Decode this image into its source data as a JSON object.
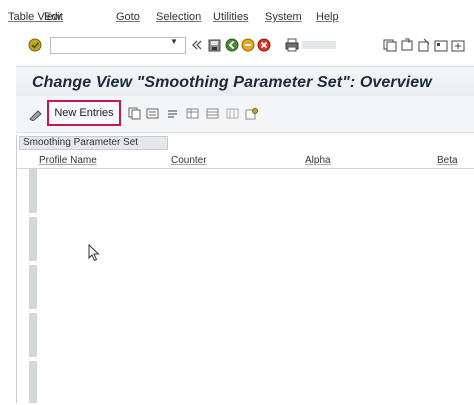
{
  "menu": {
    "items": [
      "Table View",
      "Edit",
      "Goto",
      "Selection",
      "Utilities",
      "System",
      "Help"
    ]
  },
  "toolbar": {
    "command_field_value": "",
    "icons": [
      "enter-icon",
      "back-icon",
      "exit-icon",
      "cancel-icon",
      "print-icon",
      "find-icon",
      "layout-icon",
      "help-icon"
    ]
  },
  "title": "Change View \"Smoothing Parameter Set\": Overview",
  "app_toolbar": {
    "new_entries_label": "New Entries",
    "icons": [
      "copy-icon",
      "delete-icon",
      "undo-icon",
      "select-all-icon",
      "deselect-all-icon",
      "choose-icon",
      "bc-set-icon"
    ]
  },
  "table": {
    "caption": "Smoothing Parameter Set",
    "columns": [
      "Profile Name",
      "Counter",
      "Alpha",
      "Beta"
    ]
  },
  "colors": {
    "highlight_border": "#c2185b",
    "title_bg": "#e9edf1"
  }
}
